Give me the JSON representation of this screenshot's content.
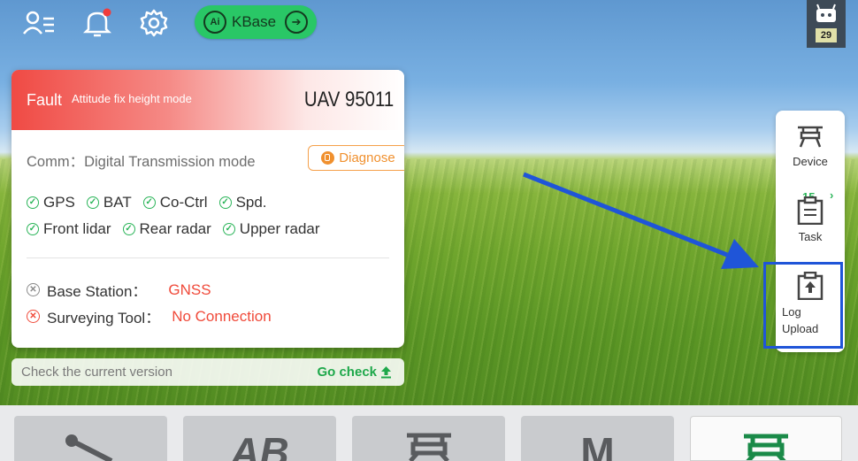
{
  "topbar": {
    "icons": [
      "user-list-icon",
      "bell-icon",
      "gear-icon"
    ],
    "kbase": {
      "ai_label": "Ai",
      "label": "KBase"
    },
    "robot_count": "29"
  },
  "card": {
    "fault_label": "Fault",
    "mode": "Attitude fix height mode",
    "uav_id": "UAV 95011",
    "comm": "Comm：Digital Transmission mode",
    "diagnose_label": "Diagnose",
    "status_items": [
      "GPS",
      "BAT",
      "Co-Ctrl",
      "Spd.",
      "Front lidar",
      "Rear radar",
      "Upper radar"
    ],
    "base_station": {
      "label": "Base Station：",
      "value": "GNSS"
    },
    "surveying_tool": {
      "label": "Surveying Tool：",
      "value": "No Connection"
    }
  },
  "version_bar": {
    "text": "Check the current version",
    "action": "Go check"
  },
  "side_panel": {
    "device_label": "Device",
    "count": "15",
    "task_label": "Task",
    "log_upload_label": "Log Upload"
  },
  "bottom_tabs": [
    {
      "label": ""
    },
    {
      "label": "AB"
    },
    {
      "label": ""
    },
    {
      "label": "M"
    },
    {
      "label": ""
    }
  ],
  "colors": {
    "fault_red": "#f04a44",
    "ok_green": "#2cb55a",
    "kbase_green": "#29c766",
    "warning_orange": "#f0902e",
    "annotation_blue": "#1f55d8"
  }
}
